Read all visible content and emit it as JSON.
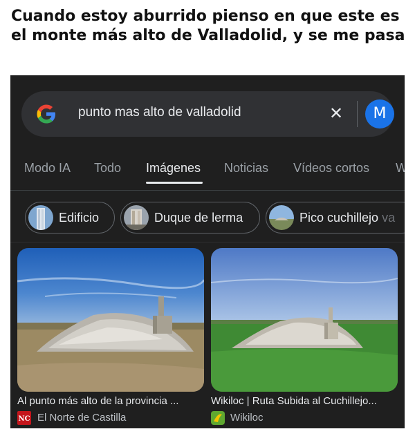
{
  "meme": {
    "caption": "Cuando estoy aburrido pienso en que este es el monte más alto de Valladolid, y se me pasa"
  },
  "search": {
    "logo_icon": "google-g-icon",
    "query": "punto mas alto de valladolid",
    "clear_label": "✕",
    "avatar_initial": "M"
  },
  "tabs": [
    {
      "label": "Modo IA",
      "active": false
    },
    {
      "label": "Todo",
      "active": false
    },
    {
      "label": "Imágenes",
      "active": true
    },
    {
      "label": "Noticias",
      "active": false
    },
    {
      "label": "Vídeos cortos",
      "active": false
    },
    {
      "label": "W",
      "active": false
    }
  ],
  "chips": [
    {
      "label": "Edificio",
      "thumb_icon": "building-thumbnail"
    },
    {
      "label": "Duque de lerma",
      "thumb_icon": "tower-thumbnail"
    },
    {
      "label": "Pico cuchillejo",
      "label_faded": " va",
      "thumb_icon": "landscape-thumbnail"
    }
  ],
  "results": [
    {
      "title": "Al punto más alto de la provincia ...",
      "source": "El Norte de Castilla",
      "favicon": "el-norte-de-castilla-icon",
      "favicon_color": "#c4161c"
    },
    {
      "title": "Wikiloc | Ruta Subida al Cuchillejo...",
      "source": "Wikiloc",
      "favicon": "wikiloc-icon",
      "favicon_color": "#5fa830"
    }
  ],
  "colors": {
    "background": "#1f1f1f",
    "searchbar": "#303134",
    "avatar": "#1a73e8",
    "text_primary": "#e8eaed",
    "text_secondary": "#9aa0a6"
  }
}
